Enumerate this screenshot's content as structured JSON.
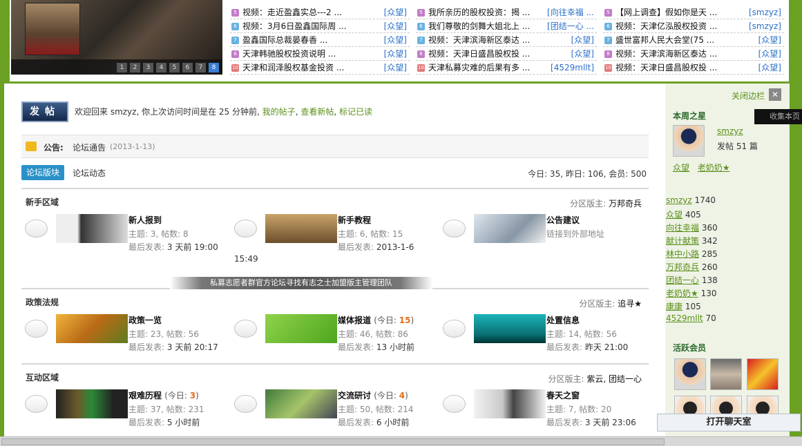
{
  "slideshow": {
    "pages": [
      "1",
      "2",
      "3",
      "4",
      "5",
      "6",
      "7",
      "8"
    ],
    "active_index": 7
  },
  "news": {
    "col1": [
      {
        "badge": "5",
        "badge_color": "#c37cc9",
        "title": "视频：走近盈鑫实总---2 ...",
        "author": "[众望]"
      },
      {
        "badge": "6",
        "badge_color": "#6ab2e0",
        "title": "视频：3月6日盈鑫国际周 ...",
        "author": "[众望]"
      },
      {
        "badge": "7",
        "badge_color": "#6ab2e0",
        "title": "盈鑫国际总裁晏春香 ...",
        "author": "[众望]"
      },
      {
        "badge": "8",
        "badge_color": "#c37cc9",
        "title": "天津韩驰股权投资说明 ...",
        "author": "[众望]"
      },
      {
        "badge": "10",
        "badge_color": "#e27a7a",
        "title": "天津和润泽股权基金投资 ...",
        "author": "[众望]"
      }
    ],
    "col2": [
      {
        "badge": "5",
        "badge_color": "#c37cc9",
        "title": "我所亲历的股权投资：揭 ...",
        "author": "[向往幸福 ..."
      },
      {
        "badge": "6",
        "badge_color": "#6ab2e0",
        "title": "我们尊敬的剑舞大姐北上 ...",
        "author": "[团结一心 ..."
      },
      {
        "badge": "7",
        "badge_color": "#6ab2e0",
        "title": "视频：天津滨海新区泰达 ...",
        "author": "[众望]"
      },
      {
        "badge": "8",
        "badge_color": "#c37cc9",
        "title": "视频：天津日盛昌股权投 ...",
        "author": "[众望]"
      },
      {
        "badge": "10",
        "badge_color": "#e27a7a",
        "title": "天津私募灾难的后果有多 ...",
        "author": "[4529mllt]"
      }
    ],
    "col3": [
      {
        "badge": "5",
        "badge_color": "#c37cc9",
        "title": "【网上调查】假如你是天 ...",
        "author": "[smzyz]"
      },
      {
        "badge": "6",
        "badge_color": "#6ab2e0",
        "title": "视频：天津亿泓股权投资 ...",
        "author": "[smzyz]"
      },
      {
        "badge": "7",
        "badge_color": "#6ab2e0",
        "title": "盛世富邦人民大会堂(75 ...",
        "author": "[众望]"
      },
      {
        "badge": "8",
        "badge_color": "#c37cc9",
        "title": "视频：天津滨海新区泰达 ...",
        "author": "[众望]"
      },
      {
        "badge": "10",
        "badge_color": "#e27a7a",
        "title": "视频：天津日盛昌股权投 ...",
        "author": "[众望]"
      }
    ]
  },
  "main": {
    "post_button": "发帖",
    "welcome_text": "欢迎回来 smzyz, 你上次访问时间是在 25 分钟前,",
    "welcome_links": [
      "我的帖子",
      "查看新帖",
      "标记已读"
    ],
    "announcement": {
      "label": "公告:",
      "text": "论坛通告",
      "date": "(2013-1-13)"
    },
    "tabs": [
      "论坛版块",
      "论坛动态"
    ],
    "stats": "今日: 35, 昨日: 106, 会员: 500",
    "banner": "私募志愿者群官方论坛寻找有志之士加盟版主管理团队"
  },
  "sections": [
    {
      "title": "新手区域",
      "moderator_label": "分区版主:",
      "moderators": "万邦奇兵",
      "forums": [
        {
          "name": "新人报到",
          "today": "",
          "meta_label": "主题: 3, 帖数: 8",
          "last_label": "最后发表:",
          "last_value": "3 天前 19:00",
          "wrap": ""
        },
        {
          "name": "新手教程",
          "today": "",
          "meta_label": "主题: 6, 帖数: 15",
          "last_label": "最后发表:",
          "last_value": "2013-1-6",
          "wrap": "15:49"
        },
        {
          "name": "公告建议",
          "today": "",
          "meta_label": "链接到外部地址",
          "last_label": "",
          "last_value": "",
          "wrap": ""
        }
      ]
    },
    {
      "title": "政策法规",
      "moderator_label": "分区版主:",
      "moderators": "追寻★",
      "forums": [
        {
          "name": "政策一览",
          "today": "",
          "meta_label": "主题: 23, 帖数: 56",
          "last_label": "最后发表:",
          "last_value": "3 天前 20:17",
          "wrap": ""
        },
        {
          "name": "媒体报道",
          "today": "15",
          "meta_label": "主题: 46, 帖数: 86",
          "last_label": "最后发表:",
          "last_value": "13 小时前",
          "wrap": ""
        },
        {
          "name": "处置信息",
          "today": "",
          "meta_label": "主题: 14, 帖数: 56",
          "last_label": "最后发表:",
          "last_value": "昨天 21:00",
          "wrap": ""
        }
      ]
    },
    {
      "title": "互动区域",
      "moderator_label": "分区版主:",
      "moderators": "紫云, 团结一心",
      "forums": [
        {
          "name": "艰难历程",
          "today": "3",
          "meta_label": "主题: 37, 帖数: 231",
          "last_label": "最后发表:",
          "last_value": "5 小时前",
          "wrap": ""
        },
        {
          "name": "交流研讨",
          "today": "4",
          "meta_label": "主题: 50, 帖数: 214",
          "last_label": "最后发表:",
          "last_value": "6 小时前",
          "wrap": ""
        },
        {
          "name": "春天之窗",
          "today": "",
          "meta_label": "主题: 7, 帖数: 20",
          "last_label": "最后发表:",
          "last_value": "3 天前 23:06",
          "wrap": ""
        }
      ]
    }
  ],
  "today_label": "今日:",
  "sidebar": {
    "close_label": "关闭边栏",
    "close_x": "✕",
    "star_title": "本周之星",
    "star_name": "smzyz",
    "star_posts": "发帖 51 篇",
    "star_links": [
      "众望",
      "老奶奶★"
    ],
    "ranking": [
      {
        "user": "smzyz",
        "count": "1740"
      },
      {
        "user": "众望",
        "count": "405"
      },
      {
        "user": "向往幸福",
        "count": "360"
      },
      {
        "user": "献计献策",
        "count": "342"
      },
      {
        "user": "林中小路",
        "count": "285"
      },
      {
        "user": "万邦奇兵",
        "count": "260"
      },
      {
        "user": "团结一心",
        "count": "138"
      },
      {
        "user": "老奶奶★",
        "count": "130"
      },
      {
        "user": "康康",
        "count": "105"
      },
      {
        "user": "4529mllt",
        "count": "70"
      }
    ],
    "active_title": "活跃会员"
  },
  "chat_button": "打开聊天室",
  "favorite_label": "收集本页",
  "colors": {
    "accent_green": "#6aa122",
    "link_green": "#5b8f19",
    "tab_blue": "#2a91c8",
    "author_blue": "#2a6fc9",
    "today_orange": "#e06e1a"
  }
}
